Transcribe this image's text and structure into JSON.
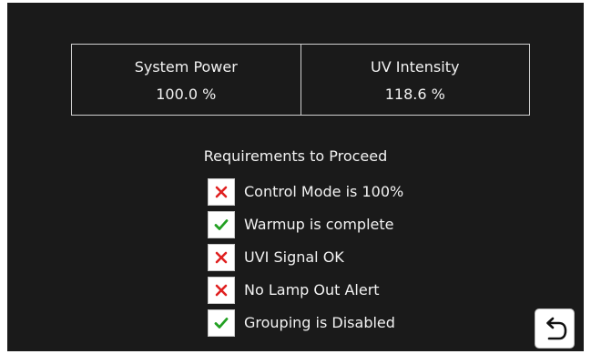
{
  "status": {
    "system_power": {
      "label": "System Power",
      "value": "100.0 %"
    },
    "uv_intensity": {
      "label": "UV Intensity",
      "value": "118.6 %"
    }
  },
  "requirements": {
    "title": "Requirements to Proceed",
    "items": [
      {
        "label": "Control Mode is 100%",
        "status": "fail",
        "icon": "x-icon"
      },
      {
        "label": "Warmup is complete",
        "status": "pass",
        "icon": "check-icon"
      },
      {
        "label": "UVI Signal OK",
        "status": "fail",
        "icon": "x-icon"
      },
      {
        "label": "No Lamp Out Alert",
        "status": "fail",
        "icon": "x-icon"
      },
      {
        "label": "Grouping is Disabled",
        "status": "pass",
        "icon": "check-icon"
      }
    ]
  },
  "colors": {
    "background": "#1a1a1a",
    "fail": "#e02020",
    "pass": "#22a022",
    "text": "#f2f2f2"
  },
  "back_button": {
    "icon": "back-arrow-icon"
  }
}
